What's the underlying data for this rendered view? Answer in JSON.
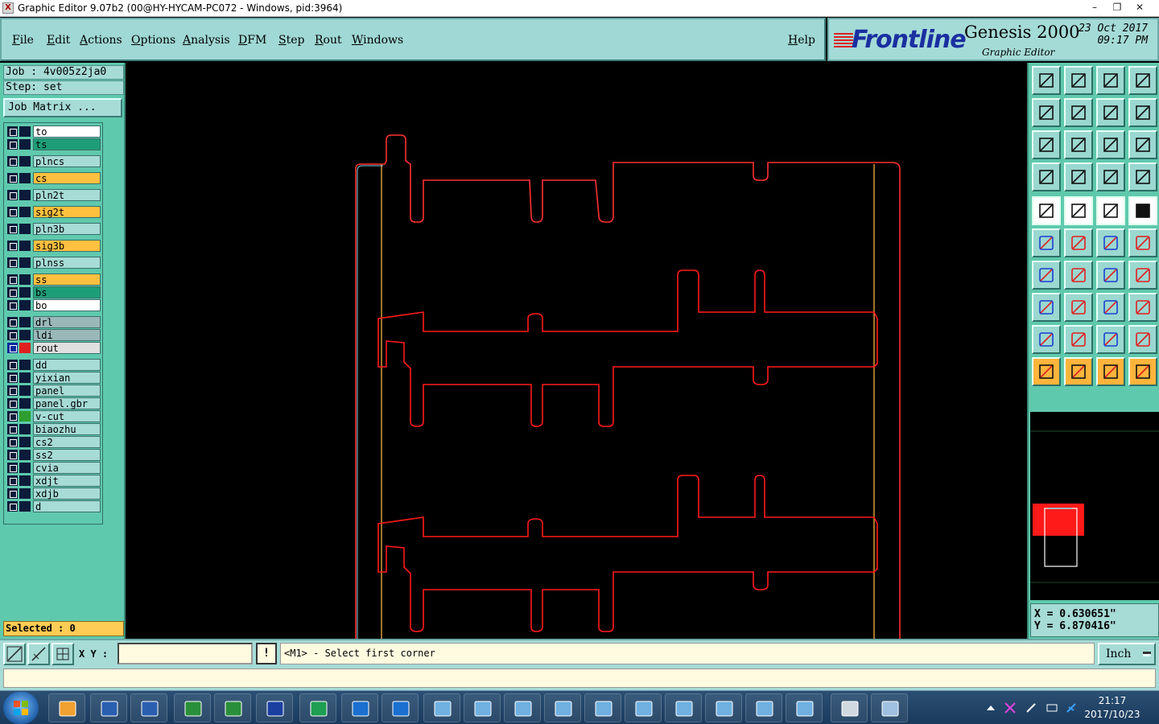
{
  "window": {
    "title": "Graphic Editor 9.07b2 (00@HY-HYCAM-PC072 - Windows, pid:3964)",
    "controls": [
      "–",
      "❐",
      "✕"
    ]
  },
  "menu": {
    "items": [
      "File",
      "Edit",
      "Actions",
      "Options",
      "Analysis",
      "DFM",
      "Step",
      "Rout",
      "Windows"
    ],
    "help": "Help"
  },
  "logo": {
    "brand": "Frontline",
    "product": "Genesis 2000",
    "subtitle": "Graphic Editor",
    "date": "23 Oct 2017",
    "time": "09:17 PM"
  },
  "job": {
    "job_label": "Job : 4v005z2ja0",
    "step_label": "Step: set",
    "matrix_button": "Job Matrix ..."
  },
  "layers": [
    {
      "name": "to",
      "bg": "#ffffff",
      "swatch": ""
    },
    {
      "name": "ts",
      "bg": "#1e9e78",
      "swatch": ""
    },
    {
      "name": "plncs",
      "bg": "#a6dbd6",
      "swatch": ""
    },
    {
      "name": "cs",
      "bg": "#ffc040",
      "swatch": ""
    },
    {
      "name": "pln2t",
      "bg": "#a6dbd6",
      "swatch": ""
    },
    {
      "name": "sig2t",
      "bg": "#ffc040",
      "swatch": ""
    },
    {
      "name": "pln3b",
      "bg": "#a6dbd6",
      "swatch": ""
    },
    {
      "name": "sig3b",
      "bg": "#ffc040",
      "swatch": ""
    },
    {
      "name": "plnss",
      "bg": "#a6dbd6",
      "swatch": ""
    },
    {
      "name": "ss",
      "bg": "#ffc040",
      "swatch": ""
    },
    {
      "name": "bs",
      "bg": "#1e9e78",
      "swatch": ""
    },
    {
      "name": "bo",
      "bg": "#ffffff",
      "swatch": ""
    },
    {
      "name": "drl",
      "bg": "#9ab8b8",
      "swatch": ""
    },
    {
      "name": "ldi",
      "bg": "#9ab8b8",
      "swatch": ""
    },
    {
      "name": "rout",
      "bg": "#e0e0e0",
      "swatch": "#e02020",
      "active": true
    },
    {
      "name": "dd",
      "bg": "#a6dbd6",
      "swatch": ""
    },
    {
      "name": "yixian",
      "bg": "#a6dbd6",
      "swatch": ""
    },
    {
      "name": "panel",
      "bg": "#a6dbd6",
      "swatch": ""
    },
    {
      "name": "panel.gbr",
      "bg": "#a6dbd6",
      "swatch": ""
    },
    {
      "name": "v-cut",
      "bg": "#a6dbd6",
      "swatch": "#2e9e30"
    },
    {
      "name": "biaozhu",
      "bg": "#a6dbd6",
      "swatch": ""
    },
    {
      "name": "cs2",
      "bg": "#a6dbd6",
      "swatch": ""
    },
    {
      "name": "ss2",
      "bg": "#a6dbd6",
      "swatch": ""
    },
    {
      "name": "cvia",
      "bg": "#a6dbd6",
      "swatch": ""
    },
    {
      "name": "xdjt",
      "bg": "#a6dbd6",
      "swatch": ""
    },
    {
      "name": "xdjb",
      "bg": "#a6dbd6",
      "swatch": ""
    },
    {
      "name": "d",
      "bg": "#a6dbd6",
      "swatch": ""
    }
  ],
  "selected": "Selected : 0",
  "coords": {
    "x": "X = 0.630651\"",
    "y": "Y = 6.870416\""
  },
  "cmd": {
    "xy_label": "X Y :",
    "xy_value": "",
    "warn": "!",
    "prompt": "<M1> - Select first corner",
    "unit": "Inch"
  },
  "taskbar": {
    "time": "21:17",
    "date": "2017/10/23"
  },
  "colors": {
    "outline_cyan": "#7fd6e8",
    "rout_red": "#ff1a1a",
    "panel_orange": "#e0a040"
  }
}
